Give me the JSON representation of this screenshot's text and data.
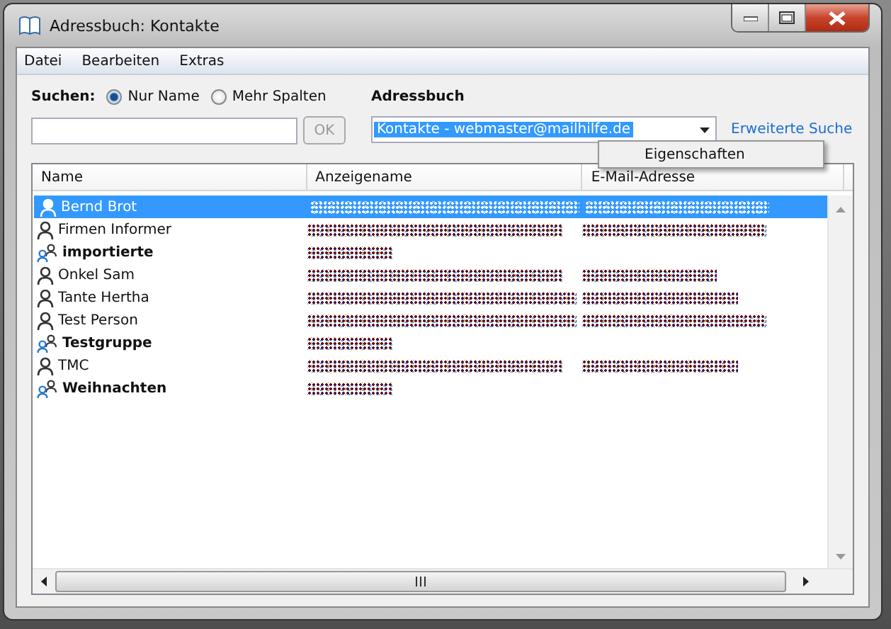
{
  "window": {
    "title": "Adressbuch: Kontakte"
  },
  "menu": [
    "Datei",
    "Bearbeiten",
    "Extras"
  ],
  "search": {
    "label": "Suchen:",
    "options": [
      {
        "label": "Nur Name",
        "selected": true
      },
      {
        "label": "Mehr Spalten",
        "selected": false
      }
    ],
    "button": "OK",
    "button_disabled": true
  },
  "addressbook": {
    "label": "Adressbuch",
    "value": "Kontakte - webmaster@mailhilfe.de",
    "link": "Erweiterte Suche"
  },
  "context_menu": {
    "items": [
      "Eigenschaften"
    ]
  },
  "table": {
    "columns": [
      "Name",
      "Anzeigename",
      "E-Mail-Adresse"
    ],
    "rows": [
      {
        "kind": "contact",
        "name": "Bernd Brot",
        "selected": true,
        "display_redacted": true,
        "email_redacted": true
      },
      {
        "kind": "contact",
        "name": "Firmen Informer",
        "selected": false,
        "display_redacted": true,
        "email_redacted": true
      },
      {
        "kind": "list",
        "name": "importierte",
        "selected": false,
        "display_redacted": true,
        "email_redacted": false
      },
      {
        "kind": "contact",
        "name": "Onkel Sam",
        "selected": false,
        "display_redacted": true,
        "email_redacted": true
      },
      {
        "kind": "contact",
        "name": "Tante Hertha",
        "selected": false,
        "display_redacted": true,
        "email_redacted": true
      },
      {
        "kind": "contact",
        "name": "Test Person",
        "selected": false,
        "display_redacted": true,
        "email_redacted": true
      },
      {
        "kind": "list",
        "name": "Testgruppe",
        "selected": false,
        "display_redacted": true,
        "email_redacted": false
      },
      {
        "kind": "contact",
        "name": "TMC",
        "selected": false,
        "display_redacted": true,
        "email_redacted": true
      },
      {
        "kind": "list",
        "name": "Weihnachten",
        "selected": false,
        "display_redacted": true,
        "email_redacted": false
      }
    ]
  }
}
